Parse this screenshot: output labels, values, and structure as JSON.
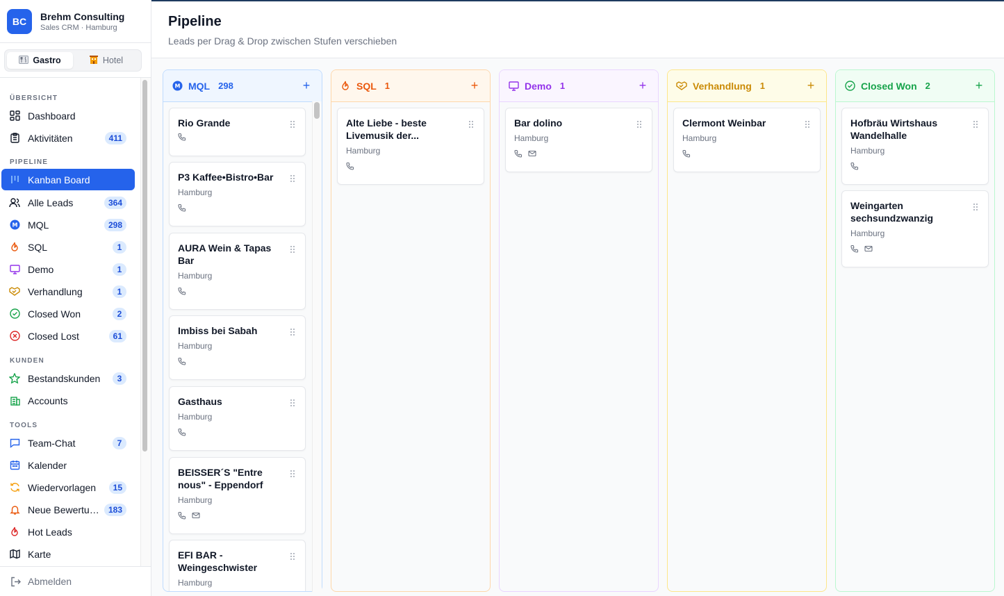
{
  "brand": {
    "logo": "BC",
    "name": "Brehm Consulting",
    "sub": "Sales CRM · Hamburg"
  },
  "segment": [
    {
      "label": "Gastro",
      "icon": "cutlery-icon",
      "active": true
    },
    {
      "label": "Hotel",
      "icon": "hotel-icon",
      "active": false
    }
  ],
  "sections": {
    "overview": "ÜBERSICHT",
    "pipeline": "PIPELINE",
    "customers": "KUNDEN",
    "tools": "TOOLS"
  },
  "nav": {
    "dashboard": {
      "label": "Dashboard",
      "icon": "dashboard-icon"
    },
    "activities": {
      "label": "Aktivitäten",
      "badge": "411",
      "icon": "clipboard-icon"
    },
    "kanban": {
      "label": "Kanban Board",
      "icon": "kanban-icon"
    },
    "all_leads": {
      "label": "Alle Leads",
      "badge": "364",
      "icon": "users-icon"
    },
    "mql": {
      "label": "MQL",
      "badge": "298",
      "icon": "mql-icon"
    },
    "sql": {
      "label": "SQL",
      "badge": "1",
      "icon": "flame-icon"
    },
    "demo": {
      "label": "Demo",
      "badge": "1",
      "icon": "monitor-icon"
    },
    "negotiation": {
      "label": "Verhandlung",
      "badge": "1",
      "icon": "handshake-icon"
    },
    "won": {
      "label": "Closed Won",
      "badge": "2",
      "icon": "check-circle-icon"
    },
    "lost": {
      "label": "Closed Lost",
      "badge": "61",
      "icon": "x-circle-icon"
    },
    "existing": {
      "label": "Bestandskunden",
      "badge": "3",
      "icon": "star-icon"
    },
    "accounts": {
      "label": "Accounts",
      "icon": "building-icon"
    },
    "chat": {
      "label": "Team-Chat",
      "badge": "7",
      "icon": "chat-icon"
    },
    "calendar": {
      "label": "Kalender",
      "icon": "calendar-icon"
    },
    "followups": {
      "label": "Wiedervorlagen",
      "badge": "15",
      "icon": "refresh-icon"
    },
    "reviews": {
      "label": "Neue Bewertungen",
      "badge": "183",
      "icon": "bell-icon"
    },
    "hot": {
      "label": "Hot Leads",
      "icon": "flame-icon"
    },
    "map": {
      "label": "Karte",
      "icon": "map-icon"
    },
    "logout": {
      "label": "Abmelden",
      "icon": "logout-icon"
    }
  },
  "header": {
    "title": "Pipeline",
    "subtitle": "Leads per Drag & Drop zwischen Stufen verschieben"
  },
  "colors": {
    "mql": "#2563eb",
    "sql": "#ea580c",
    "demo": "#9333ea",
    "negotiation": "#ca8a04",
    "won": "#16a34a"
  },
  "columns": [
    {
      "title": "MQL",
      "count": "298",
      "add": "+",
      "cards": [
        {
          "title": "Rio Grande",
          "city": "",
          "phone": true,
          "mail": false
        },
        {
          "title": "P3 Kaffee•Bistro•Bar",
          "city": "Hamburg",
          "phone": true,
          "mail": false
        },
        {
          "title": "AURA Wein & Tapas Bar",
          "city": "Hamburg",
          "phone": true,
          "mail": false
        },
        {
          "title": "Imbiss bei Sabah",
          "city": "Hamburg",
          "phone": true,
          "mail": false
        },
        {
          "title": "Gasthaus",
          "city": "Hamburg",
          "phone": true,
          "mail": false
        },
        {
          "title": "BEISSER´S \"Entre nous\" - Eppendorf",
          "city": "Hamburg",
          "phone": true,
          "mail": true
        },
        {
          "title": "EFI BAR - Weingeschwister",
          "city": "Hamburg",
          "phone": false,
          "mail": false
        }
      ]
    },
    {
      "title": "SQL",
      "count": "1",
      "add": "+",
      "cards": [
        {
          "title": "Alte Liebe - beste Livemusik der...",
          "city": "Hamburg",
          "phone": true,
          "mail": false
        }
      ]
    },
    {
      "title": "Demo",
      "count": "1",
      "add": "+",
      "cards": [
        {
          "title": "Bar dolino",
          "city": "Hamburg",
          "phone": true,
          "mail": true
        }
      ]
    },
    {
      "title": "Verhandlung",
      "count": "1",
      "add": "+",
      "cards": [
        {
          "title": "Clermont Weinbar",
          "city": "Hamburg",
          "phone": true,
          "mail": false
        }
      ]
    },
    {
      "title": "Closed Won",
      "count": "2",
      "add": "+",
      "cards": [
        {
          "title": "Hofbräu Wirtshaus Wandelhalle",
          "city": "Hamburg",
          "phone": true,
          "mail": false
        },
        {
          "title": "Weingarten sechsundzwanzig",
          "city": "Hamburg",
          "phone": true,
          "mail": true
        }
      ]
    }
  ]
}
